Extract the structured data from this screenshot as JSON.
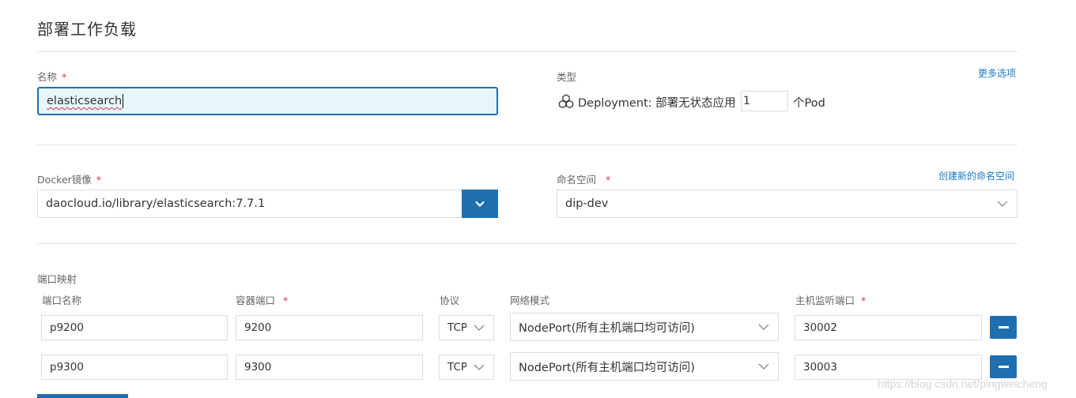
{
  "page": {
    "title": "部署工作负载"
  },
  "name_section": {
    "label": "名称",
    "required_mark": "*",
    "input_value": "elasticsearch"
  },
  "type_section": {
    "label": "类型",
    "more_options": "更多选项",
    "deployment_text": "Deployment: 部署无状态应用",
    "replica_value": "1",
    "replica_unit": "个Pod"
  },
  "docker_section": {
    "label": "Docker镜像",
    "required_mark": "*",
    "image_value": "daocloud.io/library/elasticsearch:7.7.1"
  },
  "namespace_section": {
    "label": "命名空间",
    "required_mark": "*",
    "create_link": "创建新的命名空间",
    "selected": "dip-dev"
  },
  "port_mapping": {
    "label": "端口映射",
    "columns": {
      "port_name": "端口名称",
      "container_port": "容器端口",
      "protocol": "协议",
      "network_mode": "网络模式",
      "host_port": "主机监听端口"
    },
    "required_mark": "*",
    "rows": [
      {
        "name": "p9200",
        "container_port": "9200",
        "protocol": "TCP",
        "network_mode": "NodePort(所有主机端口均可访问)",
        "host_port": "30002"
      },
      {
        "name": "p9300",
        "container_port": "9300",
        "protocol": "TCP",
        "network_mode": "NodePort(所有主机端口均可访问)",
        "host_port": "30003"
      }
    ]
  },
  "watermark": "https://blog.csdn.net/pingweicheng",
  "colors": {
    "accent": "#1f6fb0",
    "link": "#1a7ac4",
    "required": "#e0323f"
  }
}
